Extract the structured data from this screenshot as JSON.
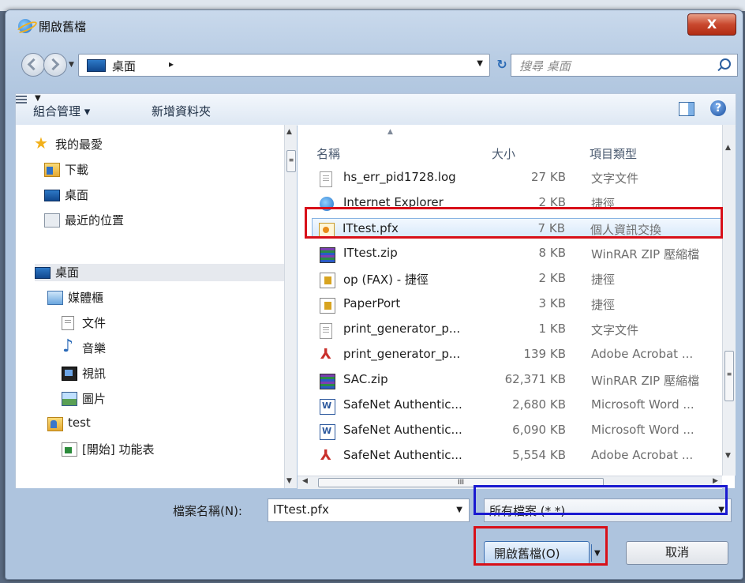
{
  "window": {
    "title": "開啟舊檔",
    "close_glyph": "X"
  },
  "address": {
    "location": "桌面",
    "path_arrow": "▸",
    "search_placeholder": "搜尋 桌面"
  },
  "toolbar": {
    "organize_label": "組合管理 ▾",
    "new_folder_label": "新增資料夾",
    "help_glyph": "?"
  },
  "nav": {
    "items": [
      {
        "label": "我的最愛",
        "icon": "star-icon"
      },
      {
        "label": "下載",
        "icon": "downloads-folder-icon"
      },
      {
        "label": "桌面",
        "icon": "desktop-icon"
      },
      {
        "label": "最近的位置",
        "icon": "recent-places-icon"
      },
      {
        "label": "桌面",
        "icon": "desktop-icon"
      },
      {
        "label": "媒體櫃",
        "icon": "libraries-icon"
      },
      {
        "label": "文件",
        "icon": "documents-icon"
      },
      {
        "label": "音樂",
        "icon": "music-icon"
      },
      {
        "label": "視訊",
        "icon": "videos-icon"
      },
      {
        "label": "圖片",
        "icon": "pictures-icon"
      },
      {
        "label": "test",
        "icon": "user-folder-icon"
      },
      {
        "label": "[開始] 功能表",
        "icon": "start-menu-icon"
      }
    ]
  },
  "files": {
    "columns": {
      "name": "名稱",
      "size": "大小",
      "type": "項目類型"
    },
    "rows": [
      {
        "name": "hs_err_pid1728.log",
        "size": "27 KB",
        "type": "文字文件",
        "icon": "text-file-icon"
      },
      {
        "name": "Internet Explorer",
        "size": "2 KB",
        "type": "捷徑",
        "icon": "internet-explorer-icon"
      },
      {
        "name": "ITtest.pfx",
        "size": "7 KB",
        "type": "個人資訊交換",
        "icon": "certificate-file-icon",
        "selected": true
      },
      {
        "name": "ITtest.zip",
        "size": "8 KB",
        "type": "WinRAR ZIP 壓縮檔",
        "icon": "winrar-zip-icon"
      },
      {
        "name": "op (FAX) - 捷徑",
        "size": "2 KB",
        "type": "捷徑",
        "icon": "shortcut-icon"
      },
      {
        "name": "PaperPort",
        "size": "3 KB",
        "type": "捷徑",
        "icon": "shortcut-icon"
      },
      {
        "name": "print_generator_p...",
        "size": "1 KB",
        "type": "文字文件",
        "icon": "text-file-icon"
      },
      {
        "name": "print_generator_p...",
        "size": "139 KB",
        "type": "Adobe Acrobat ...",
        "icon": "pdf-file-icon"
      },
      {
        "name": "SAC.zip",
        "size": "62,371 KB",
        "type": "WinRAR ZIP 壓縮檔",
        "icon": "winrar-zip-icon"
      },
      {
        "name": "SafeNet Authentic...",
        "size": "2,680 KB",
        "type": "Microsoft Word ...",
        "icon": "word-file-icon"
      },
      {
        "name": "SafeNet Authentic...",
        "size": "6,090 KB",
        "type": "Microsoft Word ...",
        "icon": "word-file-icon"
      },
      {
        "name": "SafeNet Authentic...",
        "size": "5,554 KB",
        "type": "Adobe Acrobat ...",
        "icon": "pdf-file-icon"
      }
    ]
  },
  "footer": {
    "filename_label": "檔案名稱(N):",
    "filename_value": "ITtest.pfx",
    "filetype_value": "所有檔案 (*.*)",
    "open_label": "開啟舊檔(O)",
    "cancel_label": "取消"
  },
  "colors": {
    "highlight_red": "#d81019",
    "highlight_blue": "#1a1ad0",
    "selection": "#d8e9fb"
  }
}
